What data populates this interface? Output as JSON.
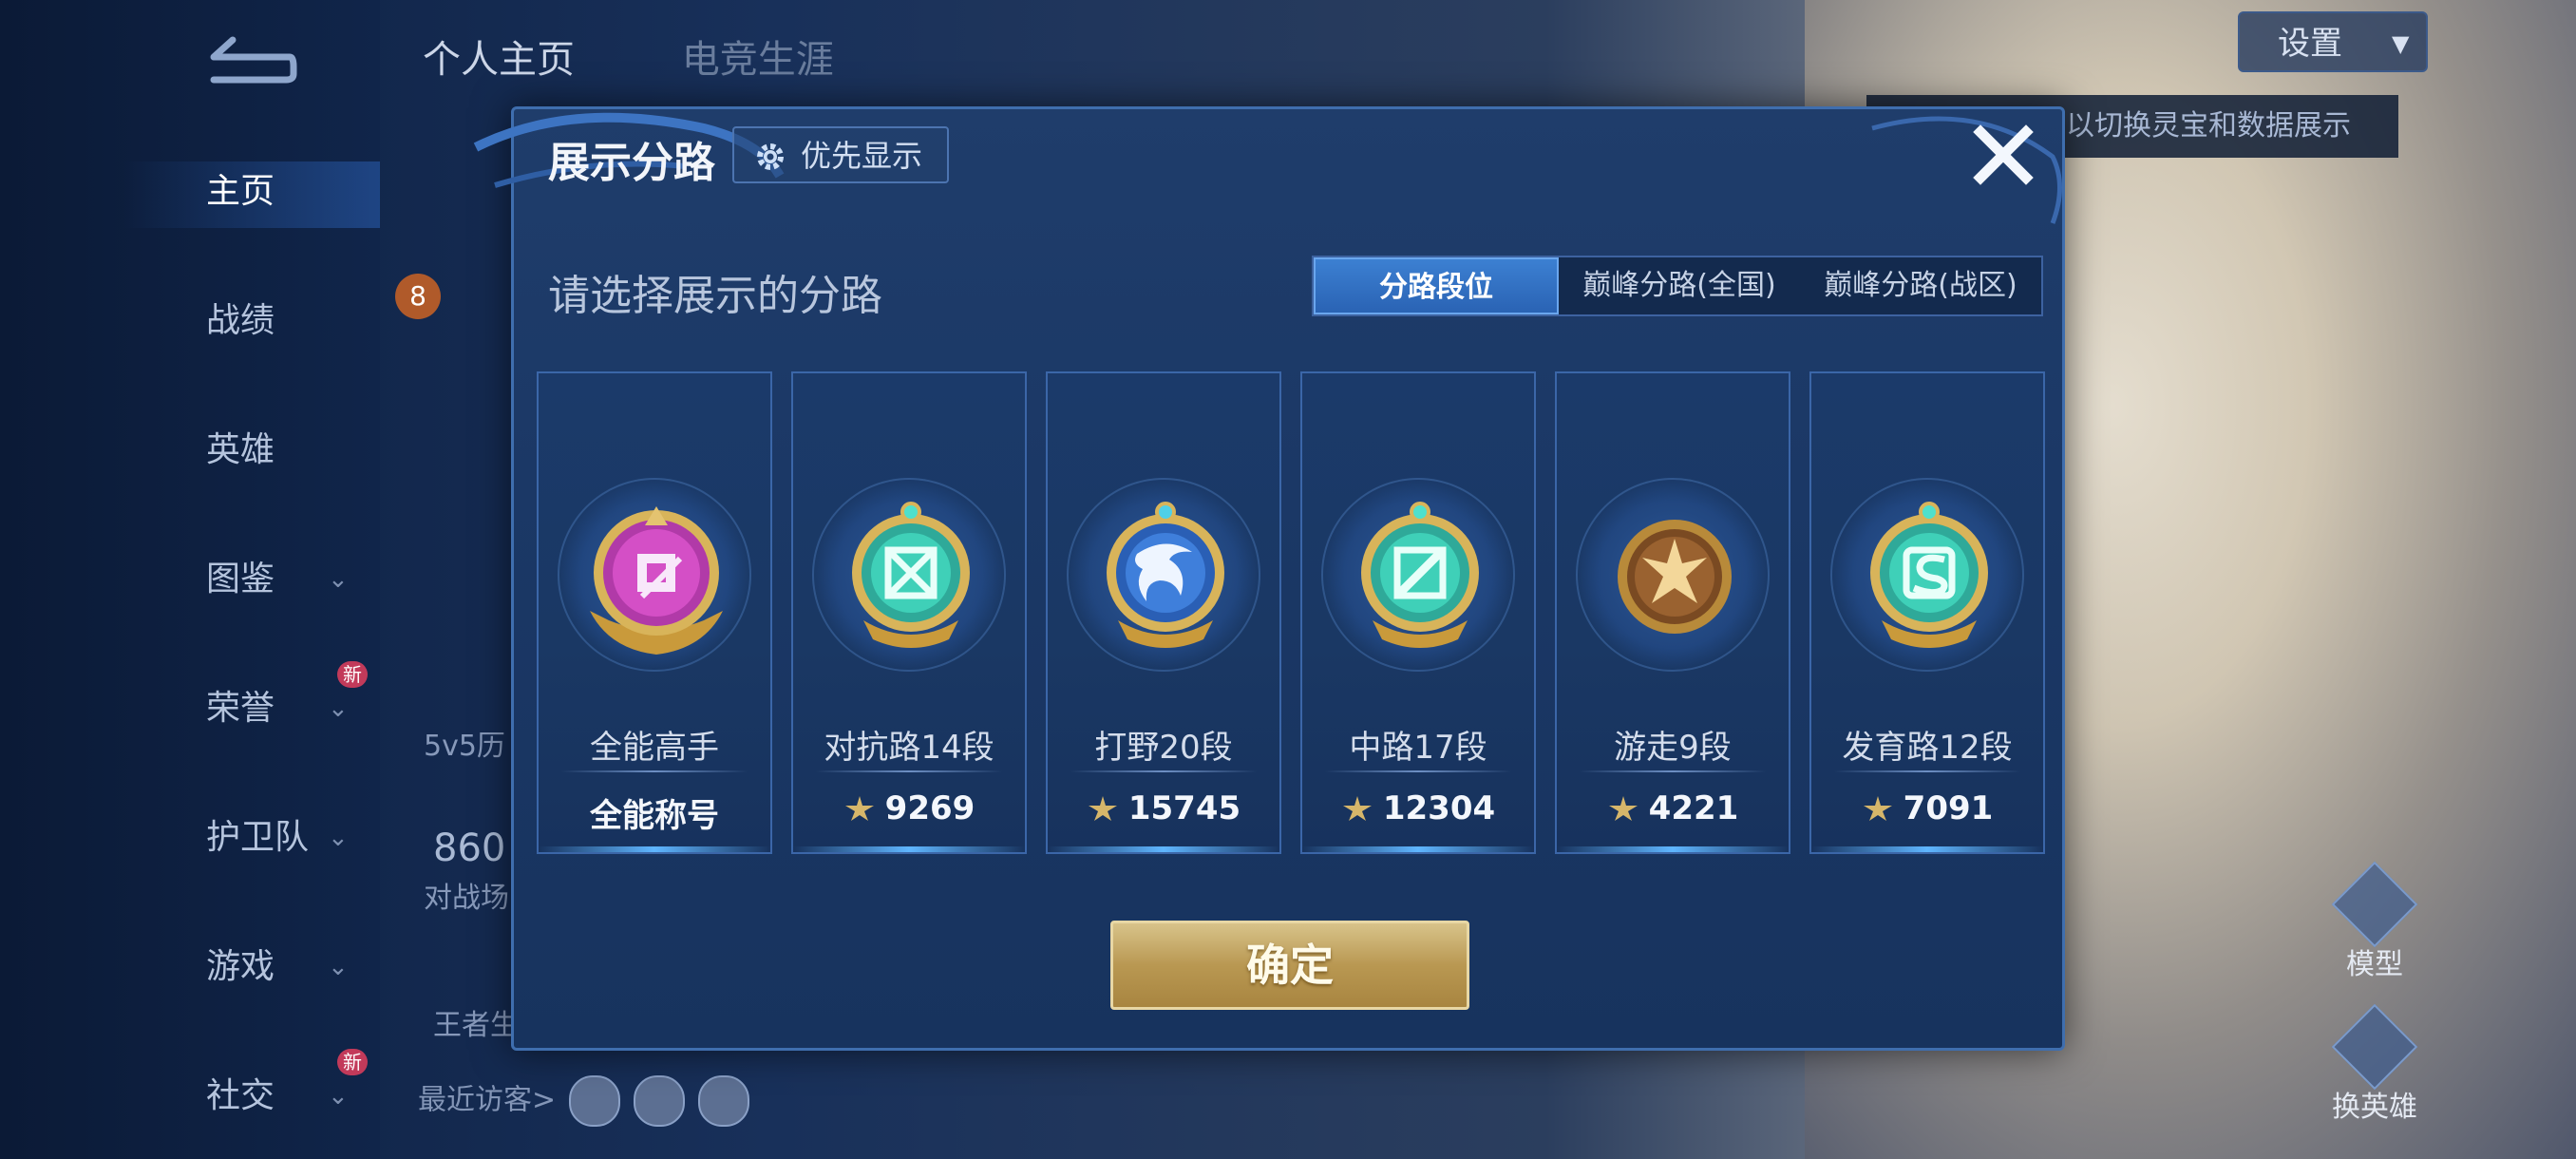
{
  "underlay": {
    "nav": [
      {
        "label": "主页",
        "new": false,
        "chevron": false
      },
      {
        "label": "战绩",
        "new": false,
        "chevron": false
      },
      {
        "label": "英雄",
        "new": false,
        "chevron": false
      },
      {
        "label": "图鉴",
        "new": false,
        "chevron": true
      },
      {
        "label": "荣誉",
        "new": true,
        "chevron": true
      },
      {
        "label": "护卫队",
        "new": false,
        "chevron": true
      },
      {
        "label": "游戏",
        "new": false,
        "chevron": true
      },
      {
        "label": "社交",
        "new": true,
        "chevron": true
      }
    ],
    "new_badge": "新",
    "top_tabs": [
      "个人主页",
      "电竞生涯"
    ],
    "settings_label": "设置",
    "hint_text": "以切换灵宝和数据展示",
    "history_label": "5v5历",
    "score": "860",
    "battle_label": "对战场",
    "king_label": "王者生",
    "visitors_label": "最近访客>",
    "side_buttons": [
      "模型",
      "换英雄"
    ],
    "level_badge": "8"
  },
  "modal": {
    "title": "展示分路",
    "pref_label": "优先显示",
    "subtitle": "请选择展示的分路",
    "tabs": [
      "分路段位",
      "巅峰分路(全国)",
      "巅峰分路(战区)"
    ],
    "active_tab": 0,
    "cards": [
      {
        "name": "全能高手",
        "value": "全能称号",
        "icon": "all-round-emblem",
        "show_value_icon": false
      },
      {
        "name": "对抗路14段",
        "value": "9269",
        "icon": "clash-lane-emblem",
        "show_value_icon": true
      },
      {
        "name": "打野20段",
        "value": "15745",
        "icon": "jungle-emblem",
        "show_value_icon": true
      },
      {
        "name": "中路17段",
        "value": "12304",
        "icon": "mid-lane-emblem",
        "show_value_icon": true
      },
      {
        "name": "游走9段",
        "value": "4221",
        "icon": "roam-emblem",
        "show_value_icon": true
      },
      {
        "name": "发育路12段",
        "value": "7091",
        "icon": "farm-lane-emblem",
        "show_value_icon": true
      }
    ],
    "confirm_label": "确定"
  },
  "colors": {
    "modal_bg": "#1b3866",
    "accent_blue": "#2a63b4",
    "gold": "#b99852"
  }
}
